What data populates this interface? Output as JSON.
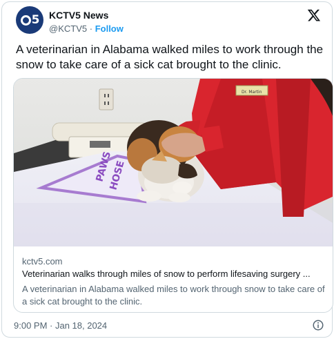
{
  "account": {
    "name": "KCTV5 News",
    "handle": "@KCTV5",
    "separator": "·",
    "follow_label": "Follow",
    "avatar_text": "5"
  },
  "tweet": {
    "text": "A veterinarian in Alabama walked miles to work through the snow to take care of a sick cat brought to the clinic."
  },
  "card": {
    "domain": "kctv5.com",
    "title": "Veterinarian walks through miles of snow to perform lifesaving surgery ...",
    "description": "A veterinarian in Alabama walked miles to work through snow to take care of a sick cat brought to the clinic.",
    "mat_text_top": "PAWS",
    "mat_text_bottom": "HOSE",
    "badge_text": "Dr. Martin"
  },
  "timestamp": "9:00 PM · Jan 18, 2024",
  "icons": [
    "x-logo-icon",
    "info-icon"
  ],
  "colors": {
    "link": "#1d9bf0",
    "scrub": "#e0252a",
    "avatar": "#1a3a78"
  }
}
